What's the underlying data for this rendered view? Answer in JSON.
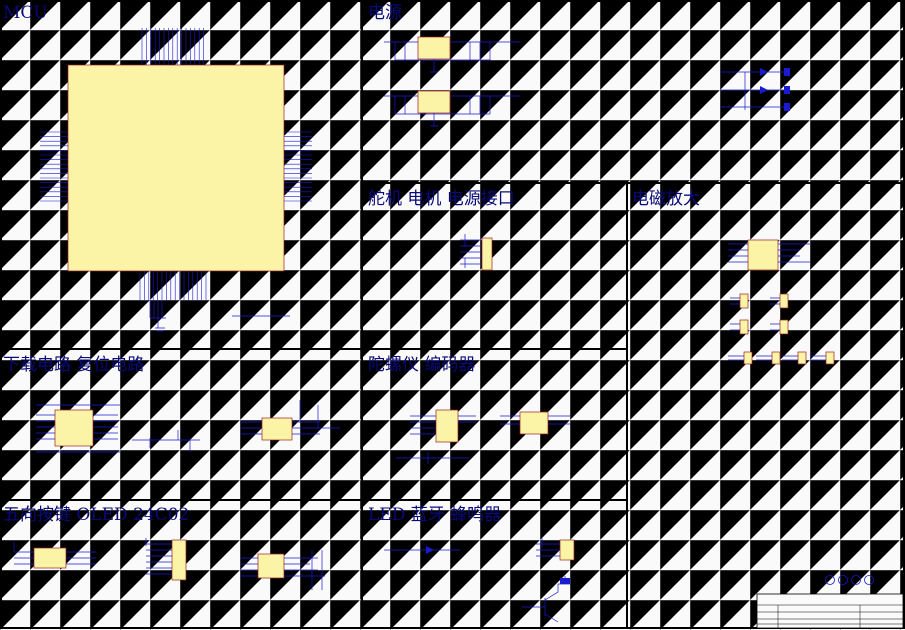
{
  "sections": [
    {
      "id": "mcu",
      "title": "MCU"
    },
    {
      "id": "power",
      "title": "电源"
    },
    {
      "id": "servo",
      "title": "舵机 电机 电源接口"
    },
    {
      "id": "em",
      "title": "电磁放大"
    },
    {
      "id": "download",
      "title": "下载电路 复位电路"
    },
    {
      "id": "gyro",
      "title": "陀螺仪 编码器"
    },
    {
      "id": "keys",
      "title": "五向按键 OLED 24C02"
    },
    {
      "id": "led",
      "title": "LED 蓝牙 蜂鸣器"
    }
  ],
  "colors": {
    "wire": "#1a1ad0",
    "chip": "#fbf3a6",
    "chip_border": "#9a2020",
    "title": "#0a0a7a",
    "border": "#000000"
  }
}
